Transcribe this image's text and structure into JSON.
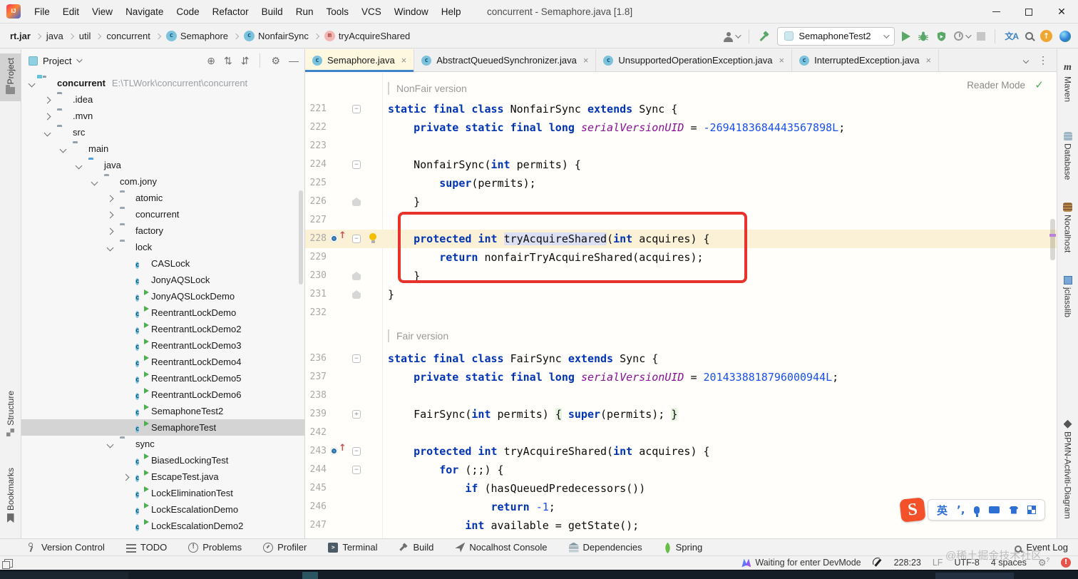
{
  "window": {
    "title": "concurrent - Semaphore.java [1.8]"
  },
  "menu": {
    "items": [
      "File",
      "Edit",
      "View",
      "Navigate",
      "Code",
      "Refactor",
      "Build",
      "Run",
      "Tools",
      "VCS",
      "Window",
      "Help"
    ]
  },
  "breadcrumbs": {
    "items": [
      {
        "label": "rt.jar",
        "bold": true
      },
      {
        "label": "java"
      },
      {
        "label": "util"
      },
      {
        "label": "concurrent"
      },
      {
        "label": "Semaphore",
        "icon": "class"
      },
      {
        "label": "NonfairSync",
        "icon": "class"
      },
      {
        "label": "tryAcquireShared",
        "icon": "method"
      }
    ]
  },
  "toolbar": {
    "run_config": "SemaphoneTest2",
    "icons": [
      "user-icon",
      "build-hammer-icon",
      "run-icon",
      "debug-icon",
      "coverage-icon",
      "profiler-icon",
      "stop-icon",
      "translate-icon",
      "search-icon",
      "update-icon",
      "plugin-sphere-icon"
    ]
  },
  "left_stripe": [
    {
      "label": "Project",
      "icon": "folder",
      "active": true
    },
    {
      "label": "Structure",
      "icon": "grid"
    },
    {
      "label": "Bookmarks",
      "icon": "flag"
    }
  ],
  "right_stripe": [
    {
      "label": "Maven",
      "icon": "maven"
    },
    {
      "label": "Database",
      "icon": "db"
    },
    {
      "label": "Nocalhost",
      "icon": "noca"
    },
    {
      "label": "jclasslib",
      "icon": "jcl"
    },
    {
      "label": "BPMN-Activiti-Diagram",
      "icon": "bpmn"
    }
  ],
  "project_panel": {
    "title": "Project",
    "tree": [
      {
        "label": "concurrent",
        "extra": "E:\\TLWork\\concurrent\\concurrent",
        "depth": 0,
        "icon": "project",
        "arrow": "open",
        "bold": true
      },
      {
        "label": ".idea",
        "depth": 1,
        "icon": "folder",
        "arrow": "closed"
      },
      {
        "label": ".mvn",
        "depth": 1,
        "icon": "folder",
        "arrow": "closed"
      },
      {
        "label": "src",
        "depth": 1,
        "icon": "folder",
        "arrow": "open"
      },
      {
        "label": "main",
        "depth": 2,
        "icon": "folder",
        "arrow": "open"
      },
      {
        "label": "java",
        "depth": 3,
        "icon": "folder-src",
        "arrow": "open"
      },
      {
        "label": "com.jony",
        "depth": 4,
        "icon": "package",
        "arrow": "open"
      },
      {
        "label": "atomic",
        "depth": 5,
        "icon": "package",
        "arrow": "closed"
      },
      {
        "label": "concurrent",
        "depth": 5,
        "icon": "package",
        "arrow": "closed"
      },
      {
        "label": "factory",
        "depth": 5,
        "icon": "package",
        "arrow": "closed"
      },
      {
        "label": "lock",
        "depth": 5,
        "icon": "package",
        "arrow": "open"
      },
      {
        "label": "CASLock",
        "depth": 6,
        "icon": "class"
      },
      {
        "label": "JonyAQSLock",
        "depth": 6,
        "icon": "class"
      },
      {
        "label": "JonyAQSLockDemo",
        "depth": 6,
        "icon": "class-run"
      },
      {
        "label": "ReentrantLockDemo",
        "depth": 6,
        "icon": "class-run"
      },
      {
        "label": "ReentrantLockDemo2",
        "depth": 6,
        "icon": "class-run"
      },
      {
        "label": "ReentrantLockDemo3",
        "depth": 6,
        "icon": "class-run"
      },
      {
        "label": "ReentrantLockDemo4",
        "depth": 6,
        "icon": "class-run"
      },
      {
        "label": "ReentrantLockDemo5",
        "depth": 6,
        "icon": "class-run"
      },
      {
        "label": "ReentrantLockDemo6",
        "depth": 6,
        "icon": "class-run"
      },
      {
        "label": "SemaphoneTest2",
        "depth": 6,
        "icon": "class-run"
      },
      {
        "label": "SemaphoreTest",
        "depth": 6,
        "icon": "class-run",
        "selected": true
      },
      {
        "label": "sync",
        "depth": 5,
        "icon": "package",
        "arrow": "open"
      },
      {
        "label": "BiasedLockingTest",
        "depth": 6,
        "icon": "class-run"
      },
      {
        "label": "EscapeTest.java",
        "depth": 6,
        "icon": "class-run",
        "arrow": "closed"
      },
      {
        "label": "LockEliminationTest",
        "depth": 6,
        "icon": "class-run"
      },
      {
        "label": "LockEscalationDemo",
        "depth": 6,
        "icon": "class-run"
      },
      {
        "label": "LockEscalationDemo2",
        "depth": 6,
        "icon": "class-run"
      }
    ]
  },
  "tabs": [
    {
      "label": "Semaphore.java",
      "active": true
    },
    {
      "label": "AbstractQueuedSynchronizer.java"
    },
    {
      "label": "UnsupportedOperationException.java"
    },
    {
      "label": "InterruptedException.java"
    }
  ],
  "editor": {
    "reader_mode_label": "Reader Mode",
    "annotation_color": "#E8322C",
    "rows": [
      {
        "type": "comment",
        "text": "NonFair version",
        "h": 32
      },
      {
        "type": "code",
        "n": "221",
        "fold": "open",
        "tokens": [
          [
            "kw",
            "static final class "
          ],
          [
            "pl",
            "NonfairSync "
          ],
          [
            "kw",
            "extends "
          ],
          [
            "pl",
            "Sync {"
          ]
        ]
      },
      {
        "type": "code",
        "n": "222",
        "tokens": [
          [
            "pl",
            "    "
          ],
          [
            "kw",
            "private static final long "
          ],
          [
            "field",
            "serialVersionUID"
          ],
          [
            "pl",
            " = "
          ],
          [
            "num",
            "-2694183684443567898L"
          ],
          [
            "pl",
            ";"
          ]
        ]
      },
      {
        "type": "code",
        "n": "223",
        "tokens": []
      },
      {
        "type": "code",
        "n": "224",
        "fold": "open",
        "tokens": [
          [
            "pl",
            "    NonfairSync("
          ],
          [
            "kw",
            "int"
          ],
          [
            "pl",
            " permits) {"
          ]
        ]
      },
      {
        "type": "code",
        "n": "225",
        "tokens": [
          [
            "pl",
            "        "
          ],
          [
            "kw",
            "super"
          ],
          [
            "pl",
            "(permits);"
          ]
        ]
      },
      {
        "type": "code",
        "n": "226",
        "fold": "end",
        "tokens": [
          [
            "pl",
            "    }"
          ]
        ]
      },
      {
        "type": "code",
        "n": "227",
        "tokens": []
      },
      {
        "type": "code",
        "n": "228",
        "fold": "open",
        "override": true,
        "bulb": true,
        "current": true,
        "tokens": [
          [
            "pl",
            "    "
          ],
          [
            "kw",
            "protected int "
          ],
          [
            "hl",
            "tryAcquireShared"
          ],
          [
            "pl",
            "("
          ],
          [
            "kw",
            "int"
          ],
          [
            "pl",
            " acquires) {"
          ]
        ]
      },
      {
        "type": "code",
        "n": "229",
        "tokens": [
          [
            "pl",
            "        "
          ],
          [
            "kw",
            "return "
          ],
          [
            "pl",
            "nonfairTryAcquireShared(acquires);"
          ]
        ]
      },
      {
        "type": "code",
        "n": "230",
        "fold": "end",
        "tokens": [
          [
            "pl",
            "    }"
          ]
        ]
      },
      {
        "type": "code",
        "n": "231",
        "fold": "end",
        "tokens": [
          [
            "pl",
            "}"
          ]
        ]
      },
      {
        "type": "code",
        "n": "232",
        "tokens": []
      },
      {
        "type": "comment",
        "text": "Fair version",
        "h": 38
      },
      {
        "type": "code",
        "n": "236",
        "fold": "open",
        "tokens": [
          [
            "kw",
            "static final class "
          ],
          [
            "pl",
            "FairSync "
          ],
          [
            "kw",
            "extends "
          ],
          [
            "pl",
            "Sync {"
          ]
        ]
      },
      {
        "type": "code",
        "n": "237",
        "tokens": [
          [
            "pl",
            "    "
          ],
          [
            "kw",
            "private static final long "
          ],
          [
            "field",
            "serialVersionUID"
          ],
          [
            "pl",
            " = "
          ],
          [
            "num",
            "2014338818796000944L"
          ],
          [
            "pl",
            ";"
          ]
        ]
      },
      {
        "type": "code",
        "n": "238",
        "tokens": []
      },
      {
        "type": "code",
        "n": "239",
        "fold": "plus",
        "tokens": [
          [
            "pl",
            "    FairSync("
          ],
          [
            "kw",
            "int"
          ],
          [
            "pl",
            " permits) "
          ],
          [
            "foldr",
            "{"
          ],
          [
            "pl",
            " "
          ],
          [
            "kw",
            "super"
          ],
          [
            "pl",
            "(permits); "
          ],
          [
            "foldr",
            "}"
          ]
        ]
      },
      {
        "type": "code",
        "n": "242",
        "tokens": []
      },
      {
        "type": "code",
        "n": "243",
        "fold": "open",
        "override": true,
        "tokens": [
          [
            "pl",
            "    "
          ],
          [
            "kw",
            "protected int "
          ],
          [
            "pl",
            "tryAcquireShared("
          ],
          [
            "kw",
            "int"
          ],
          [
            "pl",
            " acquires) {"
          ]
        ]
      },
      {
        "type": "code",
        "n": "244",
        "fold": "open",
        "tokens": [
          [
            "pl",
            "        "
          ],
          [
            "kw",
            "for "
          ],
          [
            "pl",
            "(;;) {"
          ]
        ]
      },
      {
        "type": "code",
        "n": "245",
        "tokens": [
          [
            "pl",
            "            "
          ],
          [
            "kw",
            "if "
          ],
          [
            "pl",
            "(hasQueuedPredecessors())"
          ]
        ]
      },
      {
        "type": "code",
        "n": "246",
        "tokens": [
          [
            "pl",
            "                "
          ],
          [
            "kw",
            "return "
          ],
          [
            "num",
            "-1"
          ],
          [
            "pl",
            ";"
          ]
        ]
      },
      {
        "type": "code",
        "n": "247",
        "tokens": [
          [
            "pl",
            "            "
          ],
          [
            "kw",
            "int "
          ],
          [
            "pl",
            "available = getState();"
          ]
        ]
      }
    ]
  },
  "bottom_bar": {
    "items": [
      {
        "label": "Version Control",
        "icon": "vcs"
      },
      {
        "label": "TODO",
        "icon": "todo"
      },
      {
        "label": "Problems",
        "icon": "problems"
      },
      {
        "label": "Profiler",
        "icon": "profiler"
      },
      {
        "label": "Terminal",
        "icon": "terminal"
      },
      {
        "label": "Build",
        "icon": "build"
      },
      {
        "label": "Nocalhost Console",
        "icon": "noca"
      },
      {
        "label": "Dependencies",
        "icon": "deps"
      },
      {
        "label": "Spring",
        "icon": "spring"
      }
    ],
    "event_log": "Event Log"
  },
  "status_bar": {
    "devmode": "Waiting for enter DevMode",
    "position": "228:23",
    "line_sep": "LF",
    "encoding": "UTF-8",
    "indent": "4 spaces"
  },
  "ime": {
    "lang": "英",
    "punct": "’,"
  },
  "watermark": "@稀土掘金技术社区"
}
